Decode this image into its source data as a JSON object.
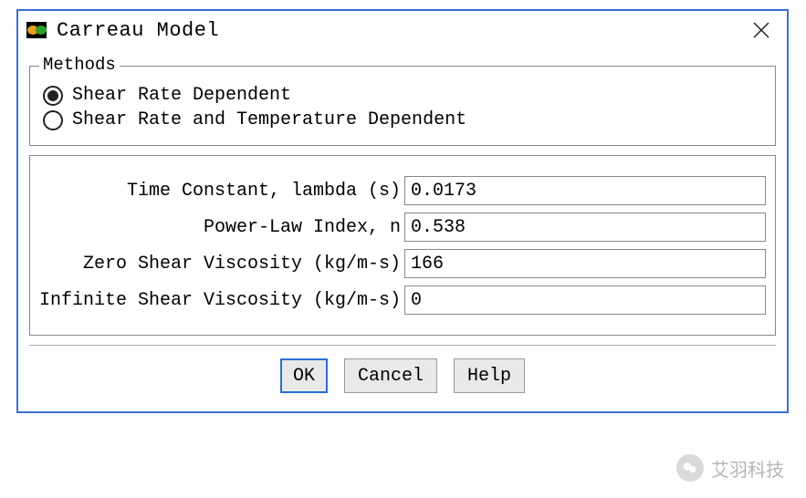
{
  "window": {
    "title": "Carreau Model"
  },
  "methods": {
    "legend": "Methods",
    "options": [
      {
        "label": "Shear Rate Dependent",
        "selected": true
      },
      {
        "label": "Shear Rate and Temperature Dependent",
        "selected": false
      }
    ]
  },
  "params": {
    "time_constant": {
      "label": "Time Constant, lambda (s)",
      "value": "0.0173"
    },
    "power_law_index": {
      "label": "Power-Law Index, n",
      "value": "0.538"
    },
    "zero_shear_viscosity": {
      "label": "Zero Shear Viscosity (kg/m-s)",
      "value": "166"
    },
    "infinite_shear_viscosity": {
      "label": "Infinite Shear Viscosity (kg/m-s)",
      "value": "0"
    }
  },
  "buttons": {
    "ok": "OK",
    "cancel": "Cancel",
    "help": "Help"
  },
  "watermark": "艾羽科技"
}
